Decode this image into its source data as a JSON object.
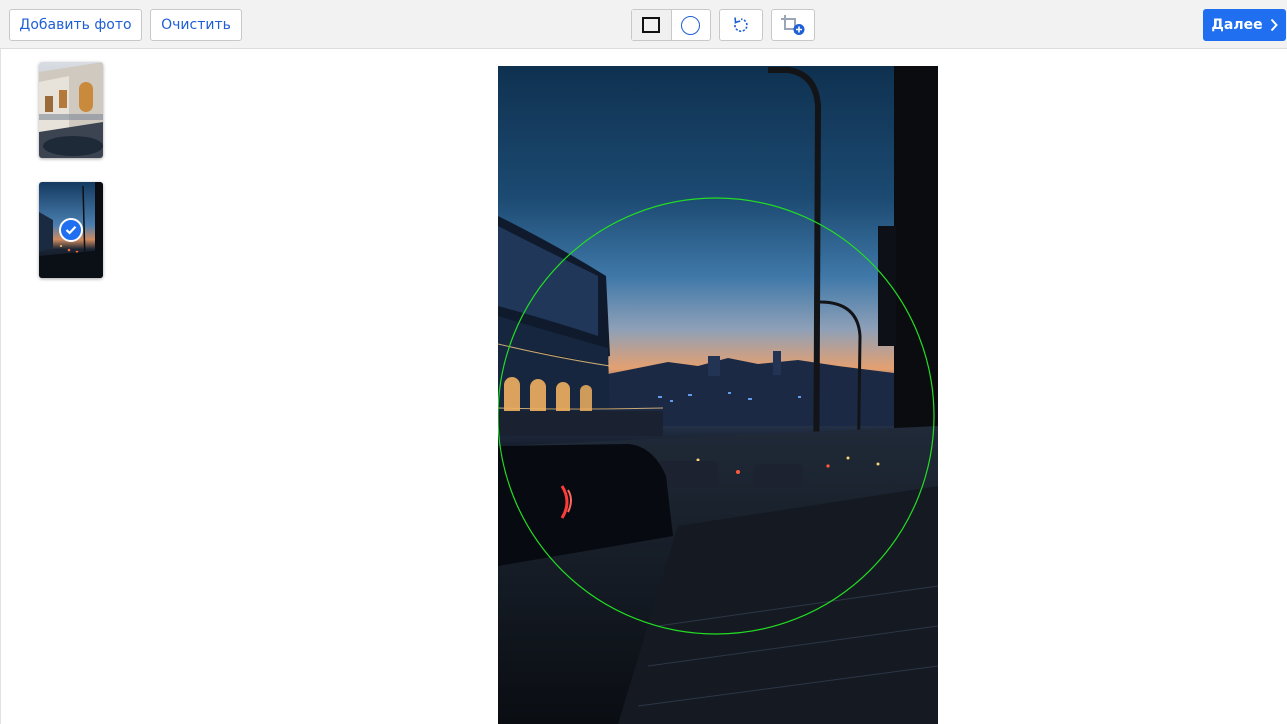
{
  "toolbar": {
    "add_photo_label": "Добавить фото",
    "clear_label": "Очистить",
    "shape_tools": [
      "square-icon",
      "circle-icon"
    ],
    "selected_shape": "circle",
    "rotate_icon": "rotate-icon",
    "crop_add_icon": "crop-add-icon",
    "next_label": "Далее"
  },
  "thumbnails": [
    {
      "name": "photo-1",
      "selected": false
    },
    {
      "name": "photo-2",
      "selected": true
    }
  ],
  "colors": {
    "accent": "#1f6ff0",
    "selection_outline": "#22dd22"
  }
}
